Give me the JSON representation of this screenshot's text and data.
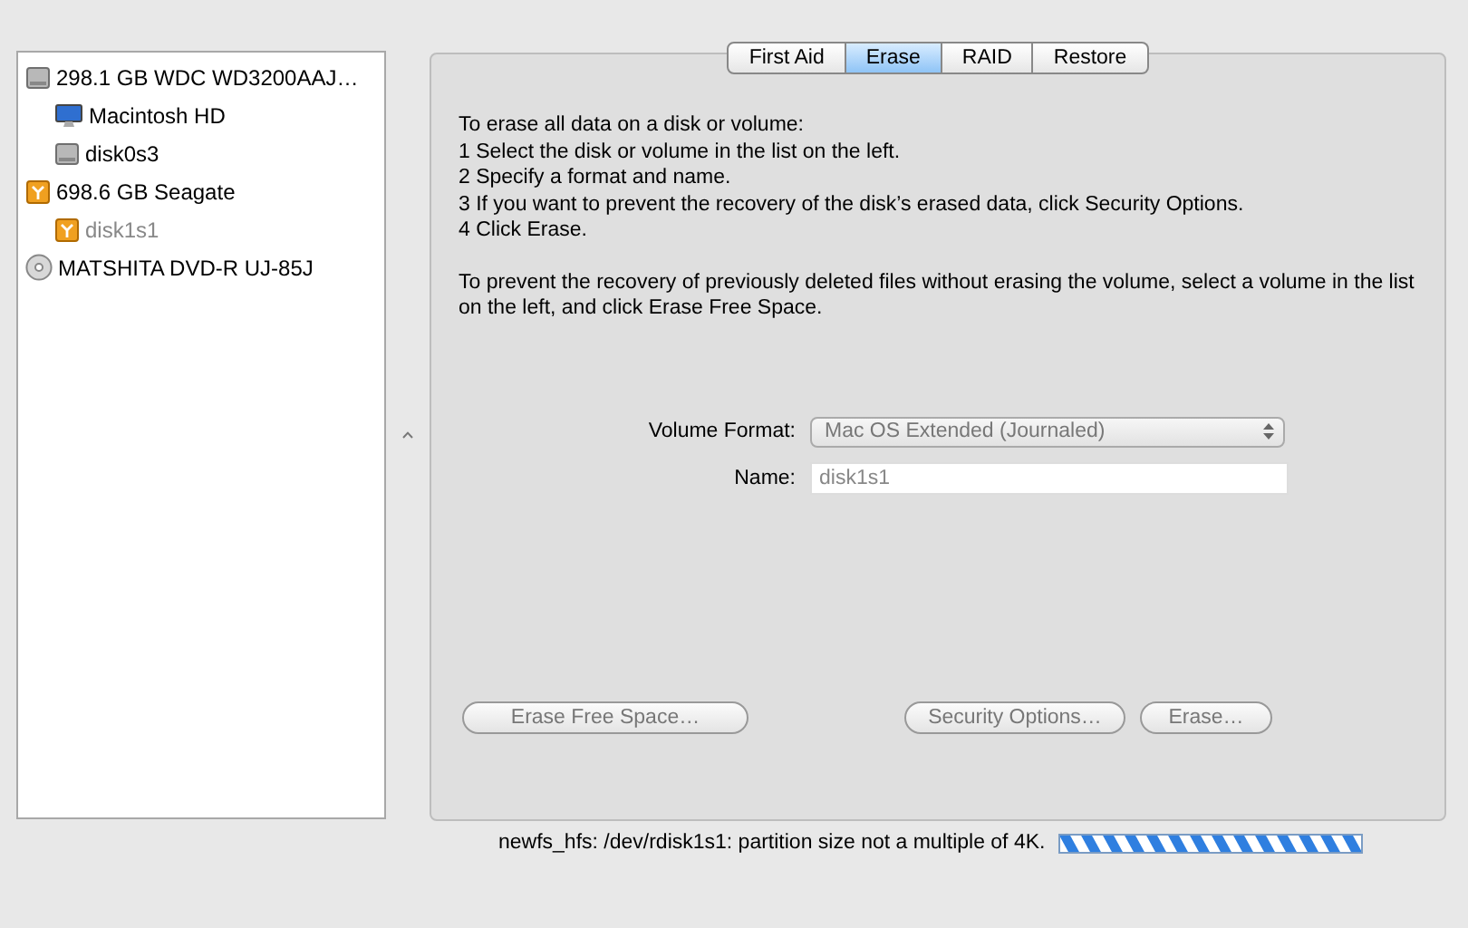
{
  "sidebar": {
    "items": [
      {
        "label": "298.1 GB WDC WD3200AAJ…",
        "kind": "hdd",
        "dimmed": false,
        "children": [
          {
            "label": "Macintosh HD",
            "kind": "monitor",
            "dimmed": false
          },
          {
            "label": "disk0s3",
            "kind": "hdd",
            "dimmed": false
          }
        ]
      },
      {
        "label": "698.6 GB Seagate",
        "kind": "external",
        "dimmed": false,
        "children": [
          {
            "label": "disk1s1",
            "kind": "external",
            "dimmed": true
          }
        ]
      },
      {
        "label": "MATSHITA DVD-R UJ-85J",
        "kind": "optical",
        "dimmed": false
      }
    ]
  },
  "tabs": [
    {
      "label": "First Aid",
      "selected": false
    },
    {
      "label": "Erase",
      "selected": true
    },
    {
      "label": "RAID",
      "selected": false
    },
    {
      "label": "Restore",
      "selected": false
    }
  ],
  "instructions": [
    "To erase all data on a disk or volume:",
    "1 Select the disk or volume in the list on the left.",
    "2 Specify a format and name.",
    "3 If you want to prevent the recovery of the disk’s erased data, click Security Options.",
    "4 Click Erase."
  ],
  "free_space_note": "To prevent the recovery of previously deleted files without erasing the volume, select a volume in the list on the left, and click Erase Free Space.",
  "volume_format": {
    "label": "Volume Format:",
    "value": "Mac OS Extended (Journaled)",
    "disabled": true
  },
  "name_field": {
    "label": "Name:",
    "value": "disk1s1",
    "disabled": true
  },
  "buttons": [
    {
      "label": "Erase Free Space…",
      "disabled": true
    },
    {
      "label": "Security Options…",
      "disabled": true
    },
    {
      "label": "Erase…",
      "disabled": true
    }
  ],
  "status": {
    "message": "newfs_hfs: /dev/rdisk1s1: partition size not a multiple of 4K.",
    "progress": {
      "indeterminate": true
    }
  }
}
